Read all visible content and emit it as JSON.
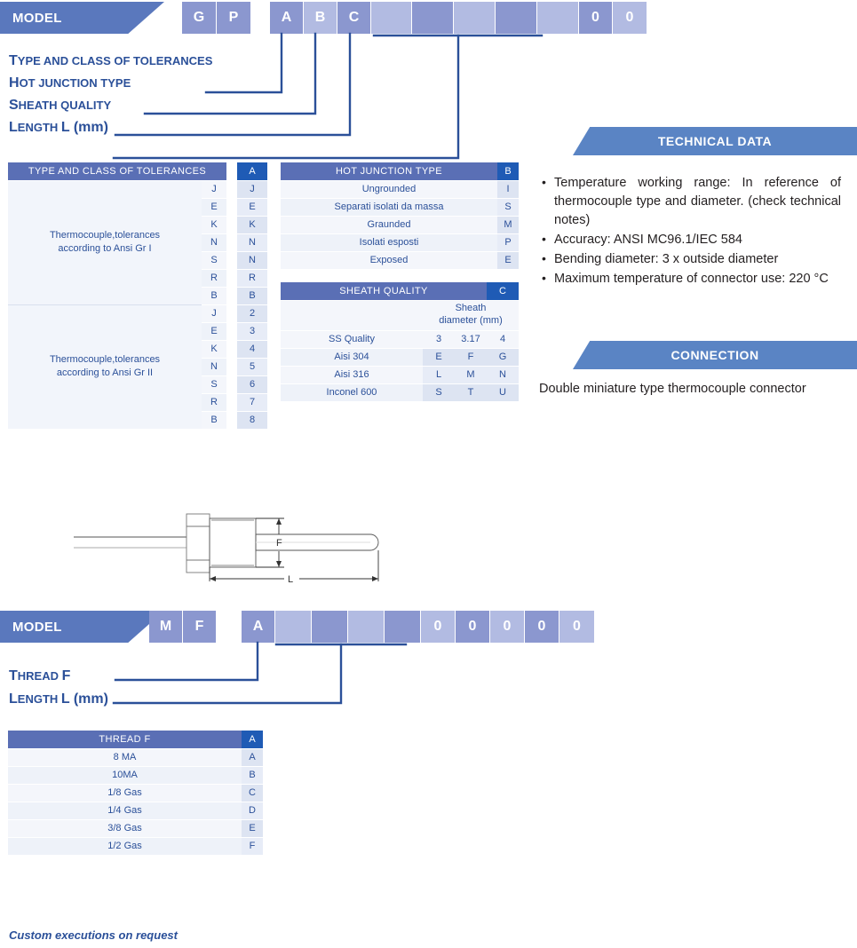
{
  "model_row_1": {
    "label": "MODEL",
    "cells": [
      {
        "text": "G",
        "shade": "dark"
      },
      {
        "text": "P",
        "shade": "dark"
      },
      {
        "text": "A",
        "shade": "dark"
      },
      {
        "text": "B",
        "shade": "light"
      },
      {
        "text": "C",
        "shade": "dark"
      },
      {
        "text": "",
        "shade": "light"
      },
      {
        "text": "",
        "shade": "dark"
      },
      {
        "text": "",
        "shade": "light"
      },
      {
        "text": "",
        "shade": "dark"
      },
      {
        "text": "",
        "shade": "light"
      },
      {
        "text": "0",
        "shade": "dark"
      },
      {
        "text": "0",
        "shade": "light"
      }
    ]
  },
  "model_row_1_labels": [
    {
      "lead": "T",
      "rest": "YPE AND CLASS OF TOLERANCES"
    },
    {
      "lead": "H",
      "rest": "OT JUNCTION TYPE"
    },
    {
      "lead": "S",
      "rest": "HEATH QUALITY"
    },
    {
      "lead": "L",
      "rest": "ENGTH ",
      "tail": "L (mm)"
    }
  ],
  "model_row_2": {
    "label": "MODEL",
    "cells": [
      {
        "text": "M",
        "shade": "dark"
      },
      {
        "text": "F",
        "shade": "dark"
      },
      {
        "text": "A",
        "shade": "dark"
      },
      {
        "text": "",
        "shade": "light"
      },
      {
        "text": "",
        "shade": "dark"
      },
      {
        "text": "",
        "shade": "light"
      },
      {
        "text": "",
        "shade": "dark"
      },
      {
        "text": "0",
        "shade": "light"
      },
      {
        "text": "0",
        "shade": "dark"
      },
      {
        "text": "0",
        "shade": "light"
      },
      {
        "text": "0",
        "shade": "dark"
      },
      {
        "text": "0",
        "shade": "light"
      }
    ]
  },
  "model_row_2_labels": [
    {
      "lead": "T",
      "rest": "HREAD ",
      "tail": "F"
    },
    {
      "lead": "L",
      "rest": "ENGTH ",
      "tail": "L (mm)"
    }
  ],
  "table_tolerances": {
    "header": "TYPE AND CLASS OF TOLERANCES",
    "code_header": "A",
    "groups": [
      {
        "name": "Thermocouple,tolerances according to Ansi Gr I",
        "name_line1": "Thermocouple,tolerances",
        "name_line2": "according to Ansi Gr I",
        "rows": [
          {
            "type": "J",
            "code": "J"
          },
          {
            "type": "E",
            "code": "E"
          },
          {
            "type": "K",
            "code": "K"
          },
          {
            "type": "N",
            "code": "N"
          },
          {
            "type": "S",
            "code": "N"
          },
          {
            "type": "R",
            "code": "R"
          },
          {
            "type": "B",
            "code": "B"
          }
        ]
      },
      {
        "name": "Thermocouple,tolerances according to Ansi Gr II",
        "name_line1": "Thermocouple,tolerances",
        "name_line2": "according to Ansi Gr II",
        "rows": [
          {
            "type": "J",
            "code": "2"
          },
          {
            "type": "E",
            "code": "3"
          },
          {
            "type": "K",
            "code": "4"
          },
          {
            "type": "N",
            "code": "5"
          },
          {
            "type": "S",
            "code": "6"
          },
          {
            "type": "R",
            "code": "7"
          },
          {
            "type": "B",
            "code": "8"
          }
        ]
      }
    ]
  },
  "table_hot_junction": {
    "header": "HOT JUNCTION TYPE",
    "code_header": "B",
    "rows": [
      {
        "name": "Ungrounded",
        "code": "I"
      },
      {
        "name": "Separati isolati da massa",
        "code": "S"
      },
      {
        "name": "Graunded",
        "code": "M"
      },
      {
        "name": "Isolati esposti",
        "code": "P"
      },
      {
        "name": "Exposed",
        "code": "E"
      }
    ]
  },
  "table_sheath": {
    "header": "SHEATH QUALITY",
    "code_header": "C",
    "sub_header_line1": "Sheath",
    "sub_header_line2": "diameter (mm)",
    "diameters": [
      "3",
      "3.17",
      "4"
    ],
    "diam_row_label": "SS Quality",
    "rows": [
      {
        "name": "Aisi 304",
        "codes": [
          "E",
          "F",
          "G"
        ]
      },
      {
        "name": "Aisi 316",
        "codes": [
          "L",
          "M",
          "N"
        ]
      },
      {
        "name": "Inconel 600",
        "codes": [
          "S",
          "T",
          "U"
        ]
      }
    ]
  },
  "table_thread": {
    "header": "THREAD F",
    "code_header": "A",
    "rows": [
      {
        "name": "8 MA",
        "code": "A"
      },
      {
        "name": "10MA",
        "code": "B"
      },
      {
        "name": "1/8 Gas",
        "code": "C"
      },
      {
        "name": "1/4 Gas",
        "code": "D"
      },
      {
        "name": "3/8 Gas",
        "code": "E"
      },
      {
        "name": "1/2 Gas",
        "code": "F"
      }
    ]
  },
  "technical_data": {
    "title": "TECHNICAL DATA",
    "items": [
      "Temperature working range: In reference of thermocouple type and diameter. (check technical notes)",
      "Accuracy: ANSI MC96.1/IEC 584",
      "Bending diameter: 3 x outside diameter",
      "Maximum temperature of connector use: 220 °C"
    ]
  },
  "connection": {
    "title": "CONNECTION",
    "text": "Double miniature type thermocouple connector"
  },
  "drawing": {
    "dim_vertical": "F",
    "dim_horizontal": "L"
  },
  "footer": {
    "note": "Custom executions on request"
  },
  "colors": {
    "banner_blue": "#5a78bd",
    "side_banner_blue": "#5a84c4",
    "header_blue": "#5a6fb5",
    "code_header_blue": "#1f5bb5",
    "cell_dark": "#8b97cf",
    "cell_light": "#b2bbe2",
    "text_blue": "#2b5099",
    "leader_line": "#2b5099"
  }
}
